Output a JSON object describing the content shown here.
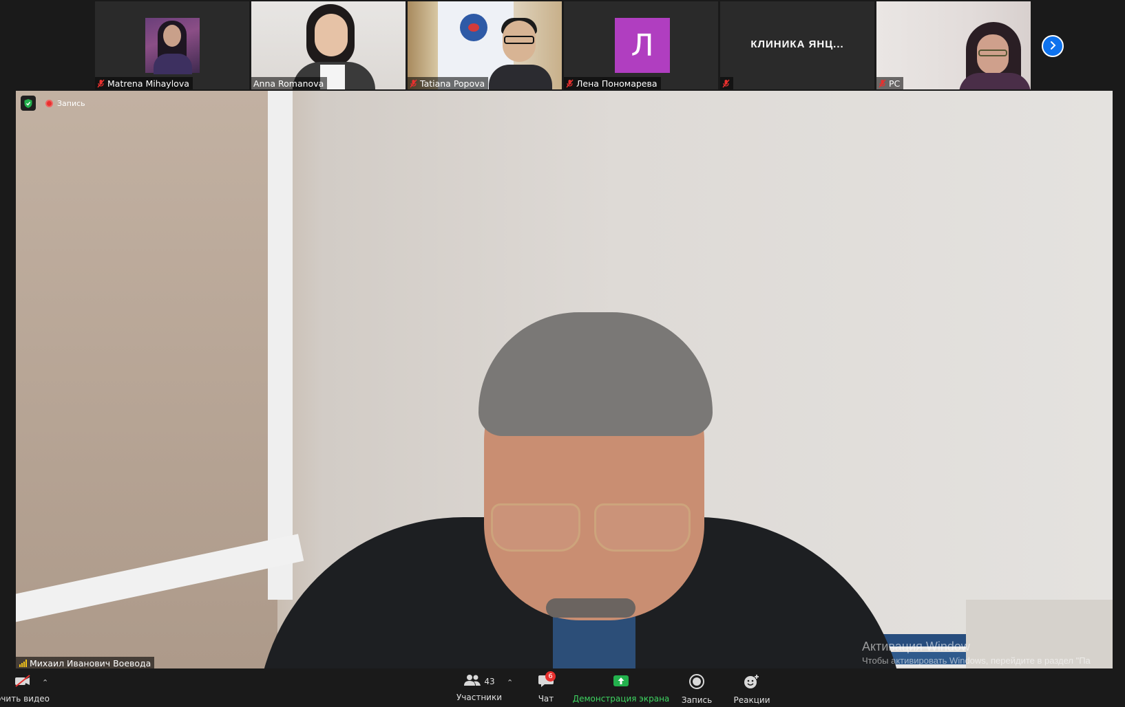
{
  "participants": [
    {
      "name": "Matrena Mihaylova",
      "muted": true
    },
    {
      "name": "Anna Romanova",
      "muted": false
    },
    {
      "name": "Tatiana Popova",
      "muted": true
    },
    {
      "name": "Лена Пономарева",
      "muted": true,
      "initial": "Л",
      "avatar_color": "#b03ec0"
    },
    {
      "name": "",
      "muted": true,
      "display_text": "КЛИНИКА ЯНЦ..."
    },
    {
      "name": "PC",
      "muted": true
    }
  ],
  "recording": {
    "label": "Запись"
  },
  "active_speaker": {
    "name": "Михаил Иванович Воевода"
  },
  "watermark": {
    "line1": "Активация Window",
    "line2": "Чтобы активировать Windows, перейдите в раздел \"Па"
  },
  "toolbar": {
    "video_label": "очить видео",
    "participants_label": "Участники",
    "participants_count": "43",
    "chat_label": "Чат",
    "chat_badge": "6",
    "share_label": "Демонстрация экрана",
    "record_label": "Запись",
    "reactions_label": "Реакции"
  },
  "colors": {
    "accent": "#0e72ed",
    "share_green": "#3ed461",
    "record_red": "#e8302e",
    "signal": "#f5c518"
  }
}
